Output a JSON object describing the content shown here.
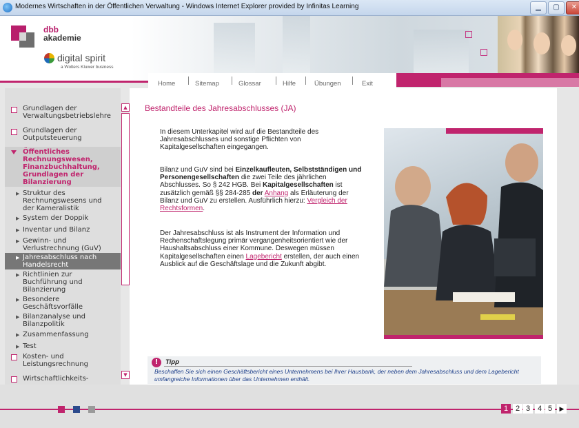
{
  "window": {
    "title": "Modernes Wirtschaften in der Öffentlichen Verwaltung - Windows Internet Explorer provided by Infinitas Learning",
    "min_icon": "minimize-icon",
    "max_icon": "maximize-icon",
    "close_icon": "close-icon"
  },
  "header": {
    "dbb_line1": "dbb",
    "dbb_line2": "akademie",
    "brand": "digital spirit",
    "brand_sub": "a Wolters Kluwer business"
  },
  "nav": {
    "items": [
      "Home",
      "Sitemap",
      "Glossar",
      "Hilfe",
      "Übungen",
      "Exit"
    ]
  },
  "sidebar": {
    "items": [
      {
        "label": "Grundlagen der\nVerwaltungsbetriebslehre",
        "level": 0
      },
      {
        "label": "Grundlagen der\nOutputsteuerung",
        "level": 0
      },
      {
        "label": "Öffentliches\nRechnungswesen,\nFinanzbuchhaltung,\nGrundlagen der\nBilanzierung",
        "level": 0,
        "expanded": true
      },
      {
        "label": "Struktur des\nRechnungswesens und\nder Kameralistik",
        "level": 1
      },
      {
        "label": "System der Doppik",
        "level": 1
      },
      {
        "label": "Inventar und Bilanz",
        "level": 1
      },
      {
        "label": "Gewinn- und\nVerlustrechnung (GuV)",
        "level": 1
      },
      {
        "label": "Jahresabschluss nach\nHandelsrecht",
        "level": 1,
        "active": true
      },
      {
        "label": "Richtlinien zur\nBuchführung und\nBilanzierung",
        "level": 1
      },
      {
        "label": "Besondere\nGeschäftsvorfälle",
        "level": 1
      },
      {
        "label": "Bilanzanalyse und\nBilanzpolitik",
        "level": 1
      },
      {
        "label": "Zusammenfassung",
        "level": 1
      },
      {
        "label": "Test",
        "level": 1
      },
      {
        "label": "Kosten- und\nLeistungsrechnung",
        "level": 0
      },
      {
        "label": "Wirtschaftlichkeits-",
        "level": 0
      }
    ]
  },
  "content": {
    "title": "Bestandteile des Jahresabschlusses (JA)",
    "p1": "In diesem Unterkapitel wird auf die Bestandteile des Jahresabschlusses und sonstige Pflichten von Kapitalgesellschaften eingegangen.",
    "p2": {
      "t1": "Bilanz und GuV sind bei ",
      "b1": "Einzelkaufleuten, Selbstständigen und Personengesellschaften",
      "t2": " die zwei Teile des jährlichen Abschlusses. So § 242 HGB. Bei ",
      "b2": "Kapitalgesellschaften",
      "t3": " ist zusätzlich gemäß §§ 284-285 ",
      "b3": "der",
      "t4": " ",
      "link1": "Anhang",
      "t5": " als Erläuterung der Bilanz und GuV zu erstellen. Ausführlich hierzu: ",
      "link2": "Vergleich der Rechtsformen",
      "t6": "."
    },
    "p3": {
      "t1": "Der Jahresabschluss ist als Instrument der Information und Rechenschaftslegung primär vergangenheitsorientiert wie der Haushaltsabschluss einer Kommune. Deswegen müssen Kapitalgesellschaften einen ",
      "link": "Lagebericht",
      "t2": " erstellen, der auch einen Ausblick auf die Geschäftslage und die Zukunft abgibt."
    }
  },
  "tipp": {
    "icon": "!",
    "title": "Tipp",
    "text": "Beschaffen Sie sich einen Geschäftsbericht eines Unternehmens bei Ihrer Hausbank, der neben dem Jahresabschluss und dem Lagebericht umfangreiche Informationen über das Unternehmen enthält."
  },
  "pager": {
    "pages": [
      "1",
      "2",
      "3",
      "4",
      "5"
    ],
    "current": "1",
    "next_icon": "▶"
  },
  "colors": {
    "accent": "#c0246d",
    "tipp_text": "#1d3f8a"
  }
}
